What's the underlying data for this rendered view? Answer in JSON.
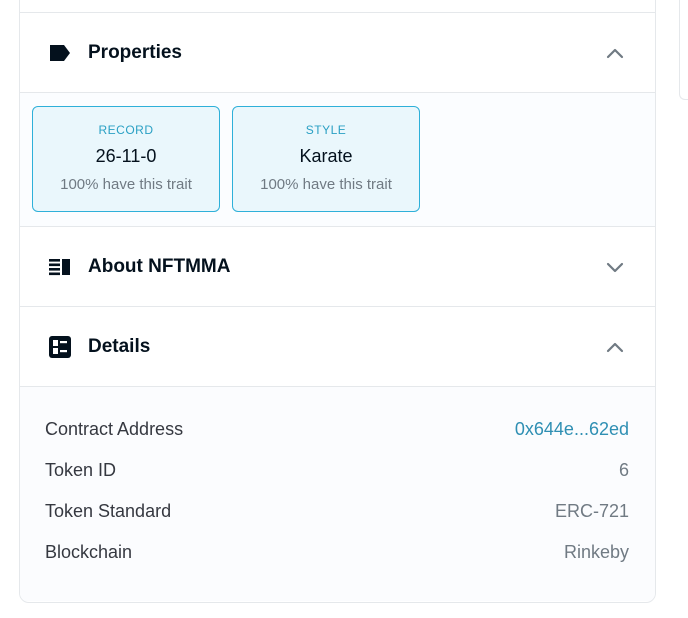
{
  "properties": {
    "title": "Properties",
    "icon": "label-tag-icon",
    "expanded": true,
    "cards": [
      {
        "type": "RECORD",
        "value": "26-11-0",
        "rarity": "100% have this trait"
      },
      {
        "type": "STYLE",
        "value": "Karate",
        "rarity": "100% have this trait"
      }
    ]
  },
  "about": {
    "title": "About NFTMMA",
    "icon": "subject-list-icon",
    "expanded": false
  },
  "details": {
    "title": "Details",
    "icon": "dashboard-icon",
    "expanded": true,
    "rows": [
      {
        "key": "Contract Address",
        "value": "0x644e...62ed"
      },
      {
        "key": "Token ID",
        "value": "6"
      },
      {
        "key": "Token Standard",
        "value": "ERC-721"
      },
      {
        "key": "Blockchain",
        "value": "Rinkeby"
      }
    ]
  },
  "colors": {
    "card_border": "#2eb0d9",
    "card_background": "#eaf7fc",
    "link": "#2f8fb3",
    "text_primary": "#04111d",
    "text_secondary": "#707a83"
  }
}
